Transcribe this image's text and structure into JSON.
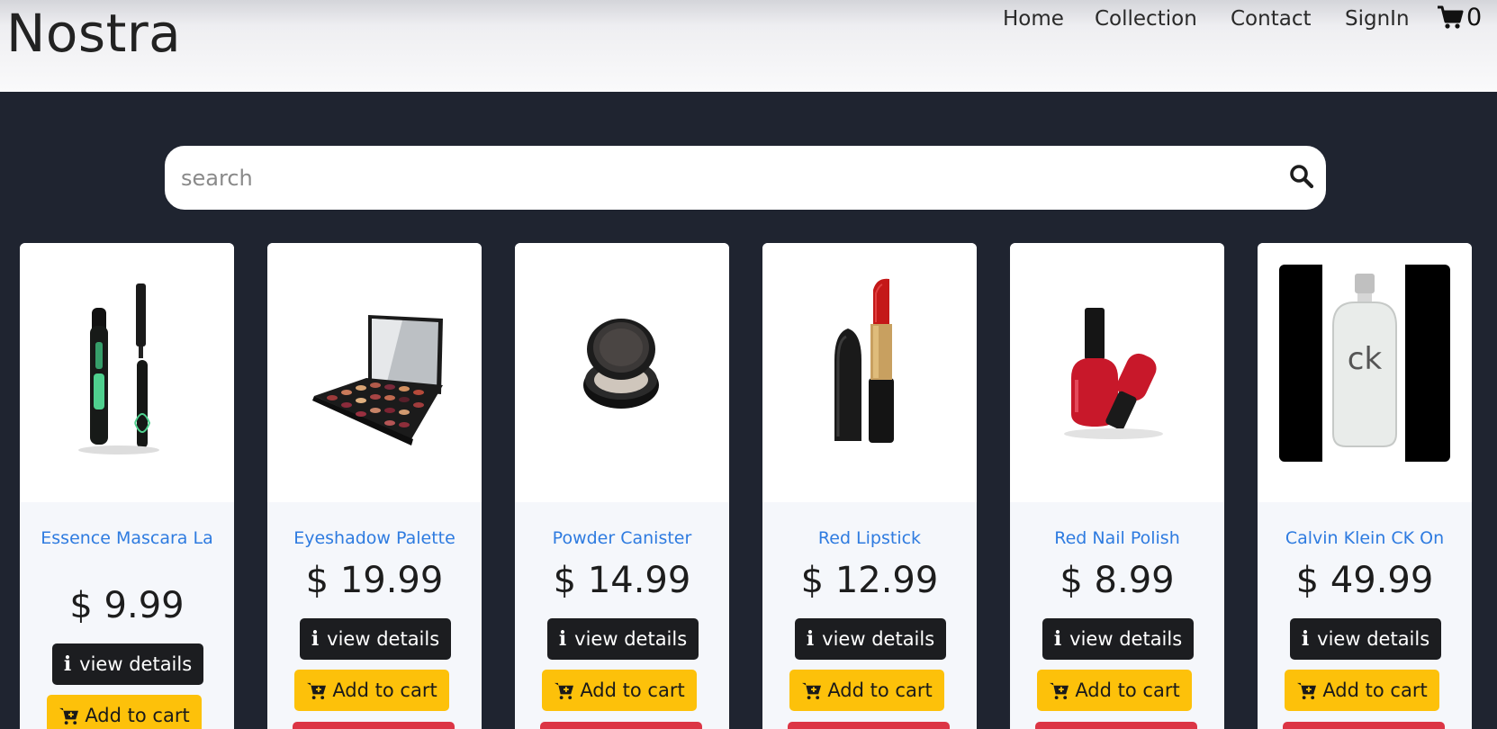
{
  "brand": "Nostra",
  "nav": {
    "home": "Home",
    "collection": "Collection",
    "contact": "Contact",
    "signin": "SignIn",
    "cart_count": "0"
  },
  "search": {
    "placeholder": "search"
  },
  "products": [
    {
      "name": "Essence Mascara La",
      "price": "$ 9.99",
      "details_label": "view details",
      "cart_label": "Add to cart",
      "image": "mascara"
    },
    {
      "name": "Eyeshadow Palette",
      "price": "$ 19.99",
      "details_label": "view details",
      "cart_label": "Add to cart",
      "image": "eyeshadow-palette"
    },
    {
      "name": "Powder Canister",
      "price": "$ 14.99",
      "details_label": "view details",
      "cart_label": "Add to cart",
      "image": "powder-compact"
    },
    {
      "name": "Red Lipstick",
      "price": "$ 12.99",
      "details_label": "view details",
      "cart_label": "Add to cart",
      "image": "lipstick"
    },
    {
      "name": "Red Nail Polish",
      "price": "$ 8.99",
      "details_label": "view details",
      "cart_label": "Add to cart",
      "image": "nail-polish"
    },
    {
      "name": "Calvin Klein CK On",
      "price": "$ 49.99",
      "details_label": "view details",
      "cart_label": "Add to cart",
      "image": "perfume-bottle"
    }
  ],
  "colors": {
    "page_bg": "#1f2430",
    "link_blue": "#2e7be0",
    "cart_yellow": "#fdc10a",
    "remove_red": "#dc3545",
    "details_dark": "#1c1d20"
  },
  "icons": {
    "cart": "shopping-cart-icon",
    "search": "search-icon",
    "info": "info-icon",
    "add_cart": "cart-plus-icon"
  }
}
